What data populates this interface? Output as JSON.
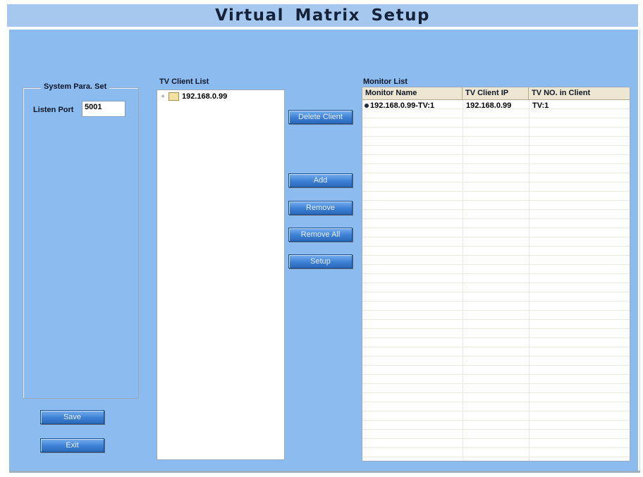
{
  "window": {
    "title": "Virtual Matrix Setup"
  },
  "system_params": {
    "group_title": "System Para. Set",
    "listen_port_label": "Listen Port",
    "listen_port_value": "5001",
    "save_label": "Save",
    "exit_label": "Exit"
  },
  "tv_client_list": {
    "label": "TV Client List",
    "items": [
      {
        "label": "192.168.0.99",
        "expander": "+"
      }
    ]
  },
  "actions": {
    "delete_client": "Delete Client",
    "add": "Add",
    "remove": "Remove",
    "remove_all": "Remove All",
    "setup": "Setup"
  },
  "monitor_list": {
    "label": "Monitor List",
    "columns": [
      "Monitor Name",
      "TV Client IP",
      "TV NO. in Client"
    ],
    "rows": [
      [
        "192.168.0.99-TV:1",
        "192.168.0.99",
        "TV:1"
      ]
    ]
  }
}
